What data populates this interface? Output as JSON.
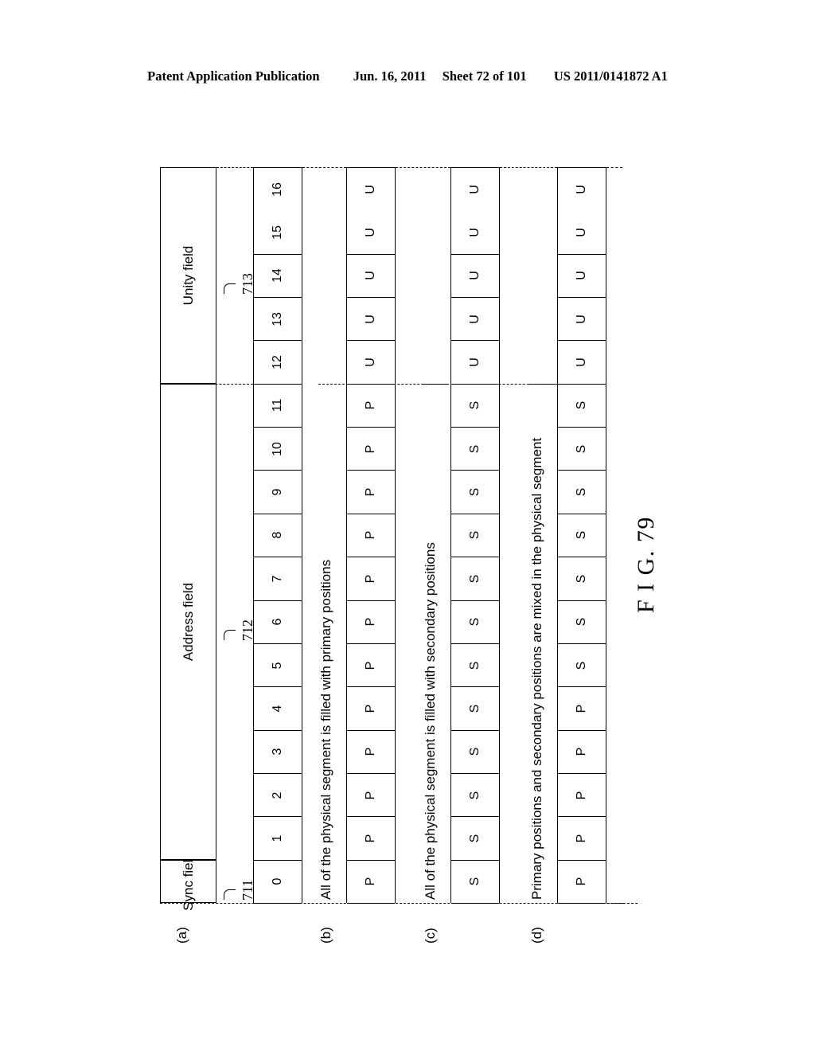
{
  "header": {
    "publication": "Patent Application Publication",
    "date": "Jun. 16, 2011",
    "sheet": "Sheet 72 of 101",
    "docnumber": "US 2011/0141872 A1"
  },
  "figure": {
    "label": "F I G. 79"
  },
  "diagram": {
    "row_labels": [
      "(a)",
      "(b)",
      "(c)",
      "(d)"
    ],
    "position_indices": [
      "0",
      "1",
      "2",
      "3",
      "4",
      "5",
      "6",
      "7",
      "8",
      "9",
      "10",
      "11",
      "12",
      "13",
      "14",
      "15",
      "16"
    ],
    "fields": [
      {
        "name": "Sync field",
        "ref": "711",
        "start": 0,
        "end": 0
      },
      {
        "name": "Address field",
        "ref": "712",
        "start": 1,
        "end": 11
      },
      {
        "name": "Unity field",
        "ref": "713",
        "start": 12,
        "end": 16
      }
    ],
    "rows": [
      {
        "key": "a",
        "label": "(a)",
        "caption": "",
        "cells": [
          "0",
          "1",
          "2",
          "3",
          "4",
          "5",
          "6",
          "7",
          "8",
          "9",
          "10",
          "11",
          "12",
          "13",
          "14",
          "15",
          "16"
        ]
      },
      {
        "key": "b",
        "label": "(b)",
        "caption": "All of the physical segment is filled with primary positions",
        "cells": [
          "P",
          "P",
          "P",
          "P",
          "P",
          "P",
          "P",
          "P",
          "P",
          "P",
          "P",
          "P",
          "U",
          "U",
          "U",
          "U",
          "U"
        ]
      },
      {
        "key": "c",
        "label": "(c)",
        "caption": "All of the physical segment is filled with secondary positions",
        "cells": [
          "S",
          "S",
          "S",
          "S",
          "S",
          "S",
          "S",
          "S",
          "S",
          "S",
          "S",
          "S",
          "U",
          "U",
          "U",
          "U",
          "U"
        ]
      },
      {
        "key": "d",
        "label": "(d)",
        "caption": "Primary positions and secondary positions are mixed in the physical segment",
        "cells": [
          "P",
          "P",
          "P",
          "P",
          "P",
          "S",
          "S",
          "S",
          "S",
          "S",
          "S",
          "S",
          "U",
          "U",
          "U",
          "U",
          "U"
        ]
      }
    ],
    "legend_symbols": {
      "primary": "P",
      "secondary": "S",
      "unity": "U"
    }
  }
}
